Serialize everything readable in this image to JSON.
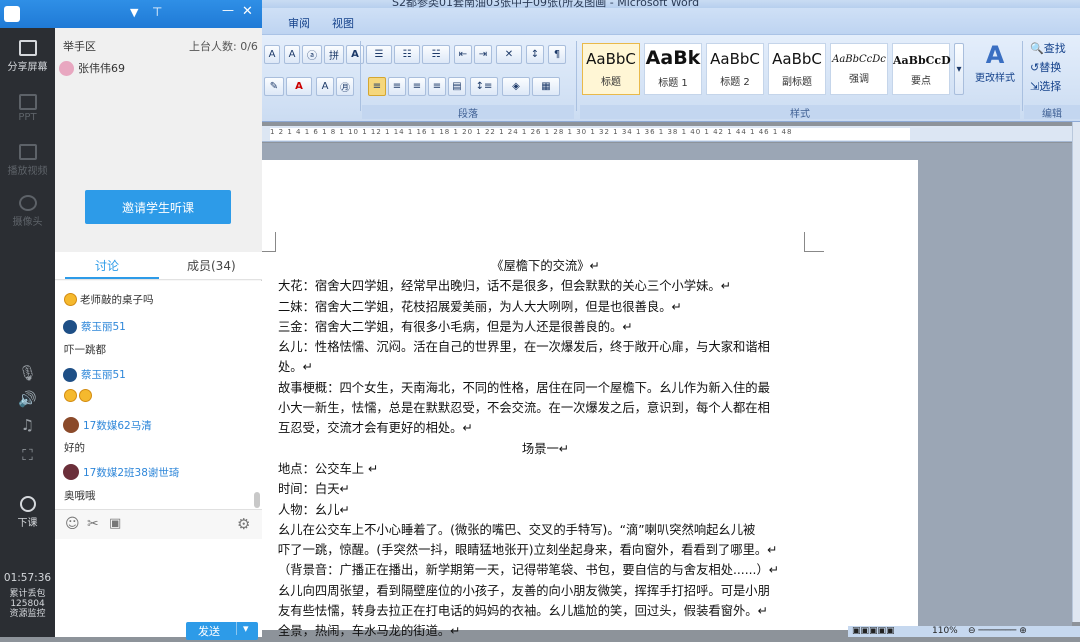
{
  "word": {
    "title": "S2都参类01套南油03张中子09张(所发图画 - Microsoft Word",
    "tabs": [
      "审阅",
      "视图"
    ],
    "groups": {
      "paragraph": "段落",
      "styles": "样式",
      "editing": "编辑"
    },
    "styles": [
      {
        "preview": "AaBbC",
        "label": "标题"
      },
      {
        "preview": "AaBk",
        "label": "标题 1"
      },
      {
        "preview": "AaBbC",
        "label": "标题 2"
      },
      {
        "preview": "AaBbC",
        "label": "副标题"
      },
      {
        "preview": "AaBbCcDc",
        "label": "强调"
      },
      {
        "preview": "AaBbCcD",
        "label": "要点"
      }
    ],
    "change_styles": "更改样式",
    "edit": {
      "find": "查找",
      "replace": "替换",
      "select": "选择"
    },
    "ruler": "1 2 1 4 1 6 1 8 1 10 1 12 1 14 1 16 1 18 1 20 1 22 1 24 1 26 1 28 1 30 1 32 1 34 1 36 1 38 1 40 1 42 1 44 1 46 1 48",
    "zoom": "110%",
    "document": {
      "lines": [
        {
          "text": "《屋檐下的交流》↵",
          "center": true
        },
        {
          "text": "大花：宿舍大四学姐，经常早出晚归，话不是很多，但会默默的关心三个小学妹。↵"
        },
        {
          "text": "二妹：宿舍大二学姐，花枝招展爱美丽，为人大大咧咧，但是也很善良。↵"
        },
        {
          "text": "三金：宿舍大二学姐，有很多小毛病，但是为人还是很善良的。↵"
        },
        {
          "text": "幺儿：性格怯懦、沉闷。活在自己的世界里，在一次爆发后，终于敞开心扉，与大家和谐相"
        },
        {
          "text": "处。↵"
        },
        {
          "text": "故事梗概：四个女生，天南海北，不同的性格，居住在同一个屋檐下。幺儿作为新入住的最"
        },
        {
          "text": "小大一新生，怯懦，总是在默默忍受，不会交流。在一次爆发之后，意识到，每个人都在相"
        },
        {
          "text": "互忍受，交流才会有更好的相处。↵"
        },
        {
          "text": "场景一↵",
          "center": true
        },
        {
          "text": "地点：公交车上  ↵"
        },
        {
          "text": "时间：白天↵"
        },
        {
          "text": "人物：幺儿↵"
        },
        {
          "text": "幺儿在公交车上不小心睡着了。(微张的嘴巴、交叉的手特写)。“滴”喇叭突然响起幺儿被"
        },
        {
          "text": "吓了一跳，惊醒。(手突然一抖，眼睛猛地张开)立刻坐起身来，看向窗外，看看到了哪里。↵"
        },
        {
          "text": "（背景音：广播正在播出，新学期第一天，记得带笔袋、书包，要自信的与舍友相处......）↵"
        },
        {
          "text": "幺儿向四周张望，看到隔壁座位的小孩子，友善的向小朋友微笑，挥挥手打招呼。可是小朋"
        },
        {
          "text": "友有些怯懦，转身去拉正在打电话的妈妈的衣袖。幺儿尴尬的笑，回过头，假装看窗外。↵"
        },
        {
          "text": "全景，热闹，车水马龙的街道。↵"
        }
      ]
    }
  },
  "sidebar": {
    "items": [
      {
        "label": "分享屏幕",
        "icon": "share-screen-icon"
      },
      {
        "label": "PPT",
        "icon": "ppt-icon"
      },
      {
        "label": "播放视频",
        "icon": "play-video-icon"
      },
      {
        "label": "摄像头",
        "icon": "camera-icon"
      }
    ],
    "end_class": "下课",
    "time": "01:57:36",
    "packet_loss_label": "累计丢包",
    "packet_loss": "125804",
    "resource_monitor": "资源监控"
  },
  "panel": {
    "raise_hand_title": "举手区",
    "on_stage_count": "上台人数: 0/6",
    "raised": [
      {
        "name": "张伟伟69"
      }
    ],
    "invite_button": "邀请学生听课",
    "tabs": {
      "discussion": "讨论",
      "members": "成员(34)"
    },
    "messages": [
      {
        "name": "",
        "text": "老师敲的桌子吗"
      },
      {
        "name": "蔡玉丽51",
        "text": "吓一跳都"
      },
      {
        "name": "蔡玉丽51",
        "text": ""
      },
      {
        "name": "17数媒62马清",
        "text": "好的"
      },
      {
        "name": "17数媒2班38谢世琦",
        "text": "奥哦哦"
      }
    ],
    "send_button": "发送"
  }
}
